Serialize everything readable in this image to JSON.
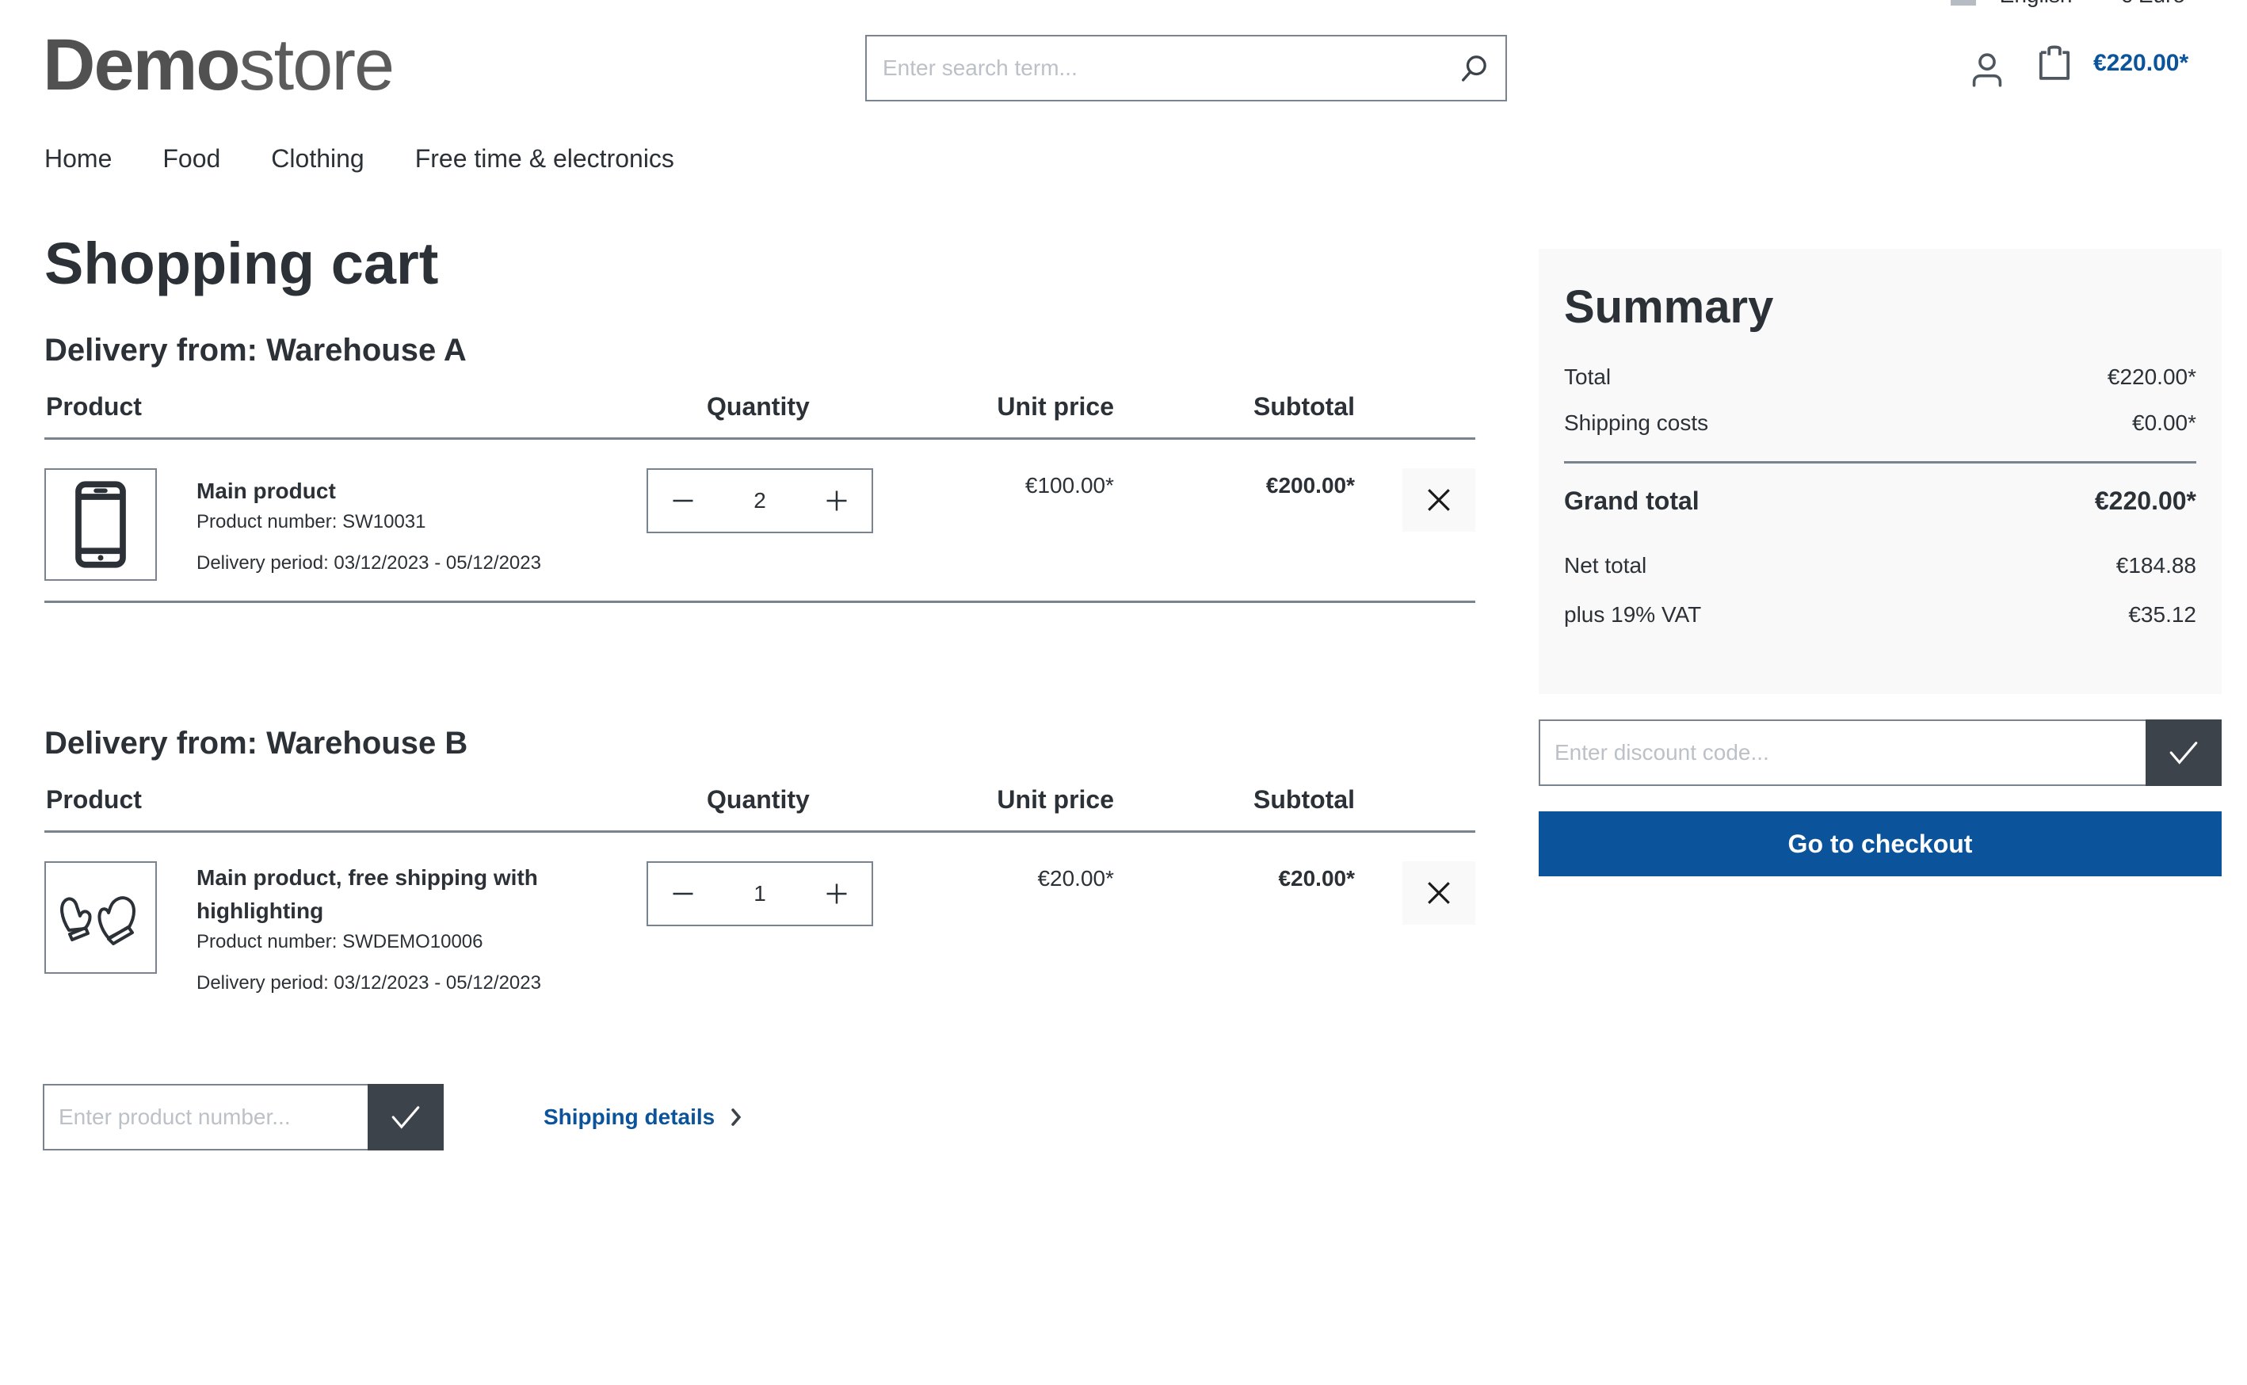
{
  "topbar": {
    "language": "English",
    "currency": "€ Euro"
  },
  "header": {
    "logo_bold": "Demo",
    "logo_light": "store",
    "search_placeholder": "Enter search term...",
    "search_icon": "search-icon",
    "account_icon": "user-icon",
    "cart_icon": "shopping-bag-icon",
    "cart_total": "€220.00*"
  },
  "nav": {
    "items": [
      {
        "label": "Home"
      },
      {
        "label": "Food"
      },
      {
        "label": "Clothing"
      },
      {
        "label": "Free time & electronics"
      }
    ]
  },
  "page_title": "Shopping cart",
  "table_headers": {
    "product": "Product",
    "quantity": "Quantity",
    "unit_price": "Unit price",
    "subtotal": "Subtotal"
  },
  "deliveries": [
    {
      "title": "Delivery from: Warehouse A",
      "items": [
        {
          "image_icon": "smartphone-icon",
          "name": "Main product",
          "product_number": "Product number: SW10031",
          "delivery_period": "Delivery period: 03/12/2023 - 05/12/2023",
          "quantity": "2",
          "unit_price": "€100.00*",
          "subtotal": "€200.00*"
        }
      ]
    },
    {
      "title": "Delivery from: Warehouse B",
      "items": [
        {
          "image_icon": "mittens-icon",
          "name": "Main product, free shipping with highlighting",
          "product_number": "Product number: SWDEMO10006",
          "delivery_period": "Delivery period: 03/12/2023 - 05/12/2023",
          "quantity": "1",
          "unit_price": "€20.00*",
          "subtotal": "€20.00*"
        }
      ]
    }
  ],
  "add_product": {
    "placeholder": "Enter product number..."
  },
  "shipping_details_link": "Shipping details",
  "summary": {
    "title": "Summary",
    "total_label": "Total",
    "total_value": "€220.00*",
    "shipping_label": "Shipping costs",
    "shipping_value": "€0.00*",
    "grand_total_label": "Grand total",
    "grand_total_value": "€220.00*",
    "net_total_label": "Net total",
    "net_total_value": "€184.88",
    "vat_label": "plus 19% VAT",
    "vat_value": "€35.12"
  },
  "discount": {
    "placeholder": "Enter discount code..."
  },
  "checkout_label": "Go to checkout",
  "colors": {
    "accent": "#0b539b",
    "dark_button": "#3d434b",
    "border": "#798490",
    "panel_bg": "#f9f9f9",
    "text": "#2b3136"
  }
}
